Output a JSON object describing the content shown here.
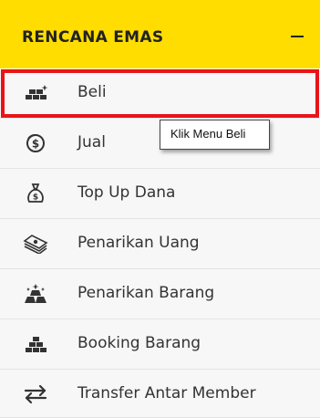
{
  "header": {
    "title": "RENCANA EMAS",
    "collapse_icon": "minus-icon",
    "background": "#FFDD00"
  },
  "menu": {
    "items": [
      {
        "label": "Beli",
        "icon": "gold-bars-sparkle-icon"
      },
      {
        "label": "Jual",
        "icon": "coin-dollar-icon"
      },
      {
        "label": "Top Up Dana",
        "icon": "money-bag-icon"
      },
      {
        "label": "Penarikan Uang",
        "icon": "cash-stack-icon"
      },
      {
        "label": "Penarikan Barang",
        "icon": "gold-bars-star-icon"
      },
      {
        "label": "Booking Barang",
        "icon": "gold-bars-icon"
      },
      {
        "label": "Transfer Antar Member",
        "icon": "transfer-arrows-icon"
      }
    ]
  },
  "highlight": {
    "color": "#E8141B",
    "target": "Beli"
  },
  "tooltip": {
    "text": "Klik Menu Beli"
  }
}
